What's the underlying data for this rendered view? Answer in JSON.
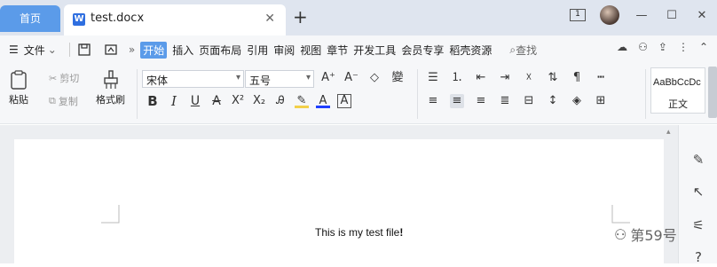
{
  "titlebar": {
    "home_tab": "首页",
    "doc_tab": "test.docx",
    "new_tab_icon": "plus-icon",
    "page_indicator": "1"
  },
  "menubar": {
    "file_label": "文件",
    "items": [
      "开始",
      "插入",
      "页面布局",
      "引用",
      "审阅",
      "视图",
      "章节",
      "开发工具",
      "会员专享",
      "稻壳资源"
    ],
    "search_label": "查找"
  },
  "ribbon": {
    "paste_label": "粘贴",
    "cut_label": "剪切",
    "copy_label": "复制",
    "format_painter_label": "格式刷",
    "font_name": "宋体",
    "font_size": "五号",
    "style_sample": "AaBbCcDc",
    "style_name": "正文"
  },
  "document": {
    "text": "This is my test file"
  },
  "watermark": {
    "text": "第59号"
  },
  "colors": {
    "accent": "#5b9be9",
    "titlebar_bg": "#dfe5ef",
    "font_color_bar": "#1f3fff",
    "highlight_bar": "#f2d04a"
  }
}
